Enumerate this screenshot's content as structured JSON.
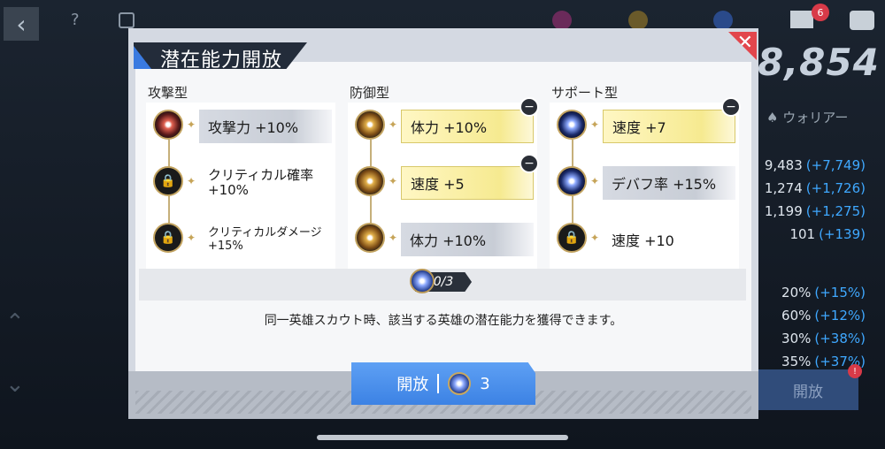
{
  "title": "潜在能力開放",
  "columns": [
    {
      "heading": "攻撃型",
      "nodes": [
        {
          "label": "攻撃力 +10%",
          "state": "unlocked-red"
        },
        {
          "label": "クリティカル確率 +10%",
          "state": "locked"
        },
        {
          "label": "クリティカルダメージ +15%",
          "state": "locked"
        }
      ]
    },
    {
      "heading": "防御型",
      "nodes": [
        {
          "label": "体力 +10%",
          "state": "selected"
        },
        {
          "label": "速度 +5",
          "state": "selected"
        },
        {
          "label": "体力 +10%",
          "state": "unlocked"
        }
      ]
    },
    {
      "heading": "サポート型",
      "nodes": [
        {
          "label": "速度 +7",
          "state": "selected"
        },
        {
          "label": "デバフ率 +15%",
          "state": "unlocked-blue"
        },
        {
          "label": "速度 +10",
          "state": "locked"
        }
      ]
    }
  ],
  "progress": {
    "current": "0",
    "total": "3"
  },
  "footnote": "同一英雄スカウト時、該当する英雄の潜在能力を獲得できます。",
  "open_button": {
    "label": "開放",
    "cost": "3"
  },
  "background": {
    "power": "8,854",
    "class_label": "ウォリアー",
    "mail_badge": "6",
    "right_open_label": "開放",
    "right_badge": "!",
    "stats": [
      {
        "value": "9,483",
        "bonus": "(+7,749)"
      },
      {
        "value": "1,274",
        "bonus": "(+1,726)"
      },
      {
        "value": "1,199",
        "bonus": "(+1,275)"
      },
      {
        "value": "101",
        "bonus": "(+139)"
      },
      {
        "value": "20%",
        "bonus": "(+15%)"
      },
      {
        "value": "60%",
        "bonus": "(+12%)"
      },
      {
        "value": "30%",
        "bonus": "(+38%)"
      },
      {
        "value": "35%",
        "bonus": "(+37%)"
      }
    ]
  },
  "colors": {
    "accent_blue": "#3c82e4",
    "close_red": "#e2464c",
    "bonus_blue": "#3fa8ff"
  }
}
